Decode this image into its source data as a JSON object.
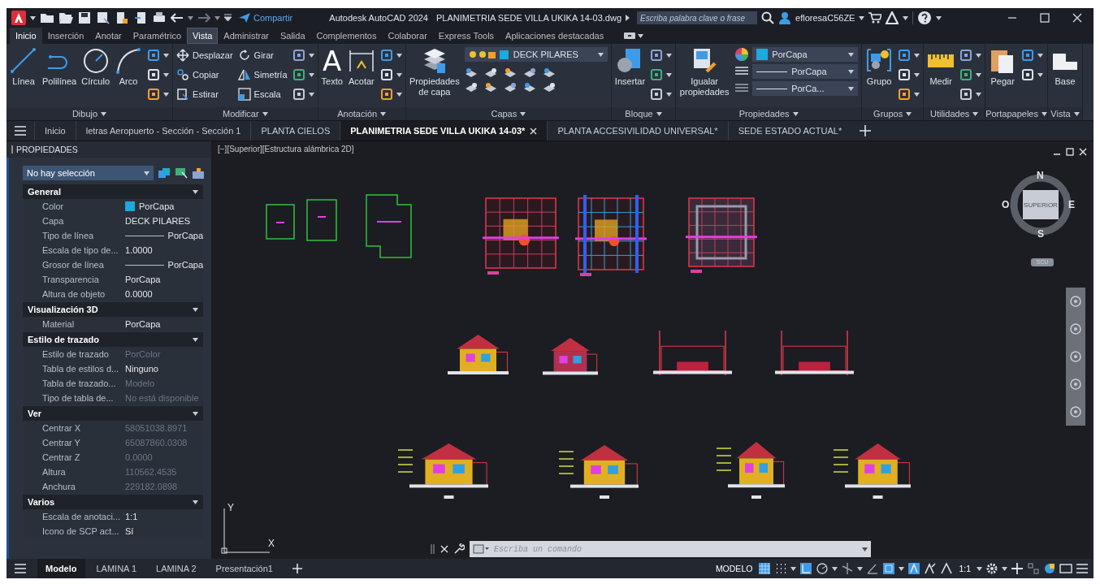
{
  "title_bar": {
    "share": "Compartir",
    "app_name": "Autodesk AutoCAD 2024",
    "file_name": "PLANIMETRIA SEDE VILLA UKIKA 14-03.dwg",
    "search": {
      "placeholder": "Escriba palabra clave o frase"
    },
    "user": "efloresaC56ZE"
  },
  "ribbon_tabs": [
    {
      "label": "Inicio",
      "selected": true,
      "highlighted": false
    },
    {
      "label": "Inserción",
      "selected": false,
      "highlighted": false
    },
    {
      "label": "Anotar",
      "selected": false,
      "highlighted": false
    },
    {
      "label": "Paramétrico",
      "selected": false,
      "highlighted": false
    },
    {
      "label": "Vista",
      "selected": false,
      "highlighted": true
    },
    {
      "label": "Administrar",
      "selected": false,
      "highlighted": false
    },
    {
      "label": "Salida",
      "selected": false,
      "highlighted": false
    },
    {
      "label": "Complementos",
      "selected": false,
      "highlighted": false
    },
    {
      "label": "Colaborar",
      "selected": false,
      "highlighted": false
    },
    {
      "label": "Express Tools",
      "selected": false,
      "highlighted": false
    },
    {
      "label": "Aplicaciones destacadas",
      "selected": false,
      "highlighted": false
    }
  ],
  "ribbon_panels": [
    {
      "label": "Dibujo",
      "columns": [
        {
          "kind": "large",
          "label": "Línea"
        },
        {
          "kind": "large",
          "label": "Polilínea"
        },
        {
          "kind": "large",
          "label": "Círculo"
        },
        {
          "kind": "large",
          "label": "Arco"
        },
        {
          "kind": "stack",
          "items": [
            {
              "kind": "icon"
            },
            {
              "kind": "icon"
            },
            {
              "kind": "icon"
            }
          ]
        }
      ]
    },
    {
      "label": "Modificar",
      "columns": [
        {
          "kind": "stack",
          "items": [
            {
              "kind": "labeled",
              "label": "Desplazar"
            },
            {
              "kind": "labeled",
              "label": "Copiar"
            },
            {
              "kind": "labeled",
              "label": "Estirar"
            }
          ]
        },
        {
          "kind": "stack",
          "items": [
            {
              "kind": "labeled",
              "label": "Girar"
            },
            {
              "kind": "labeled",
              "label": "Simetría"
            },
            {
              "kind": "labeled",
              "label": "Escala"
            }
          ]
        },
        {
          "kind": "stack",
          "items": [
            {
              "kind": "icon"
            },
            {
              "kind": "icon"
            },
            {
              "kind": "icon"
            }
          ]
        }
      ]
    },
    {
      "label": "Anotación",
      "columns": [
        {
          "kind": "glyph",
          "glyph": "A",
          "label": "Texto"
        },
        {
          "kind": "large",
          "label": "Acotar"
        },
        {
          "kind": "stack",
          "items": [
            {
              "kind": "icon"
            },
            {
              "kind": "icon"
            },
            {
              "kind": "icon"
            }
          ]
        }
      ]
    },
    {
      "label": "Capas",
      "columns": [
        {
          "kind": "large",
          "label": "Propiedades de capa"
        },
        {
          "kind": "layer",
          "value": "DECK PILARES"
        }
      ]
    },
    {
      "label": "Bloque",
      "columns": [
        {
          "kind": "large",
          "label": "Insertar"
        },
        {
          "kind": "stack",
          "items": [
            {
              "kind": "icon"
            },
            {
              "kind": "icon"
            },
            {
              "kind": "icon"
            }
          ]
        }
      ]
    },
    {
      "label": "Propiedades",
      "columns": [
        {
          "kind": "large",
          "label": "Igualar propiedades"
        },
        {
          "kind": "dropdowns",
          "items": [
            "PorCapa",
            "PorCapa",
            "PorCa..."
          ]
        }
      ]
    },
    {
      "label": "Grupos",
      "columns": [
        {
          "kind": "large",
          "label": "Grupo"
        },
        {
          "kind": "stack",
          "items": [
            {
              "kind": "icon"
            },
            {
              "kind": "icon"
            },
            {
              "kind": "icon"
            }
          ]
        }
      ]
    },
    {
      "label": "Utilidades",
      "columns": [
        {
          "kind": "large",
          "label": "Medir"
        },
        {
          "kind": "stack",
          "items": [
            {
              "kind": "icon"
            },
            {
              "kind": "icon"
            },
            {
              "kind": "icon"
            }
          ]
        }
      ]
    },
    {
      "label": "Portapapeles",
      "columns": [
        {
          "kind": "large",
          "label": "Pegar"
        },
        {
          "kind": "stack",
          "items": [
            {
              "kind": "icon"
            },
            {
              "kind": "icon"
            }
          ]
        }
      ]
    },
    {
      "label": "Vista",
      "columns": [
        {
          "kind": "large",
          "label": "Base"
        }
      ]
    }
  ],
  "document_tabs": [
    {
      "label": "Inicio",
      "selected": false
    },
    {
      "label": "letras Aeropuerto - Sección - Sección 1",
      "selected": false
    },
    {
      "label": "PLANTA CIELOS",
      "selected": false
    },
    {
      "label": "PLANIMETRIA SEDE VILLA UKIKA 14-03*",
      "selected": true
    },
    {
      "label": "PLANTA ACCESIVILIDAD UNIVERSAL*",
      "selected": false
    },
    {
      "label": "SEDE ESTADO ACTUAL*",
      "selected": false
    }
  ],
  "properties_panel": {
    "title": "PROPIEDADES",
    "selection": "No hay selección",
    "sections": [
      {
        "title": "General",
        "rows": [
          {
            "label": "Color",
            "value": "PorCapa",
            "kind": "color",
            "color": "#1ea8e0",
            "disabled": false
          },
          {
            "label": "Capa",
            "value": "DECK PILARES",
            "kind": "text",
            "disabled": false
          },
          {
            "label": "Tipo de línea",
            "value": "PorCapa",
            "kind": "linetype",
            "disabled": false
          },
          {
            "label": "Escala de tipo de...",
            "value": "1.0000",
            "kind": "text",
            "disabled": false
          },
          {
            "label": "Grosor de línea",
            "value": "PorCapa",
            "kind": "linetype",
            "disabled": false
          },
          {
            "label": "Transparencia",
            "value": "PorCapa",
            "kind": "text",
            "disabled": false
          },
          {
            "label": "Altura de objeto",
            "value": "0.0000",
            "kind": "text",
            "disabled": false
          }
        ]
      },
      {
        "title": "Visualización 3D",
        "rows": [
          {
            "label": "Material",
            "value": "PorCapa",
            "kind": "text",
            "disabled": false
          }
        ]
      },
      {
        "title": "Estilo de trazado",
        "rows": [
          {
            "label": "Estilo de trazado",
            "value": "PorColor",
            "kind": "text",
            "disabled": true
          },
          {
            "label": "Tabla de estilos d...",
            "value": "Ninguno",
            "kind": "text",
            "disabled": false
          },
          {
            "label": "Tabla de trazado...",
            "value": "Modelo",
            "kind": "text",
            "disabled": true
          },
          {
            "label": "Tipo de tabla de...",
            "value": "No está disponible",
            "kind": "text",
            "disabled": true
          }
        ]
      },
      {
        "title": "Ver",
        "rows": [
          {
            "label": "Centrar X",
            "value": "58051038.8971",
            "kind": "text",
            "disabled": true
          },
          {
            "label": "Centrar Y",
            "value": "65087860.0308",
            "kind": "text",
            "disabled": true
          },
          {
            "label": "Centrar Z",
            "value": "0.0000",
            "kind": "text",
            "disabled": true
          },
          {
            "label": "Altura",
            "value": "110562.4535",
            "kind": "text",
            "disabled": true
          },
          {
            "label": "Anchura",
            "value": "229182.0898",
            "kind": "text",
            "disabled": true
          }
        ]
      },
      {
        "title": "Varios",
        "rows": [
          {
            "label": "Escala de anotaci...",
            "value": "1:1",
            "kind": "text",
            "disabled": false
          },
          {
            "label": "Icono de SCP act...",
            "value": "Sí",
            "kind": "text",
            "disabled": false
          }
        ]
      }
    ]
  },
  "viewport": {
    "label": "[−][Superior][Estructura alámbrica 2D]",
    "view_cube": {
      "face": "SUPERIOR",
      "north": "N",
      "south": "S",
      "east": "E",
      "west": "O",
      "coordinate_system": "SCU"
    },
    "ucs_icon": {
      "x": "X",
      "y": "Y"
    },
    "command_line": {
      "placeholder": "Escriba un comando"
    }
  },
  "layout_tabs": [
    {
      "label": "Modelo",
      "selected": true
    },
    {
      "label": "LAMINA 1",
      "selected": false
    },
    {
      "label": "LAMINA 2",
      "selected": false
    },
    {
      "label": "Presentación1",
      "selected": false
    }
  ],
  "status_bar": {
    "space": "MODELO",
    "scale": "1:1"
  }
}
